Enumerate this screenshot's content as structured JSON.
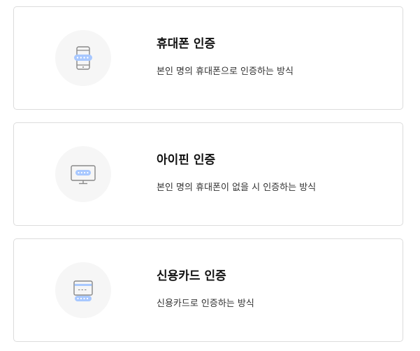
{
  "auth_methods": [
    {
      "title": "휴대폰 인증",
      "description": "본인 명의 휴대폰으로 인증하는 방식",
      "icon": "mobile-phone-icon"
    },
    {
      "title": "아이핀 인증",
      "description": "본인 명의 휴대폰이 없을 시 인증하는 방식",
      "icon": "monitor-icon"
    },
    {
      "title": "신용카드 인증",
      "description": "신용카드로 인증하는 방식",
      "icon": "credit-card-icon"
    }
  ],
  "colors": {
    "accent_blue": "#a8c8ff",
    "icon_gray": "#888888",
    "card_border": "#dcdcdc",
    "icon_bg": "#f6f6f6"
  }
}
